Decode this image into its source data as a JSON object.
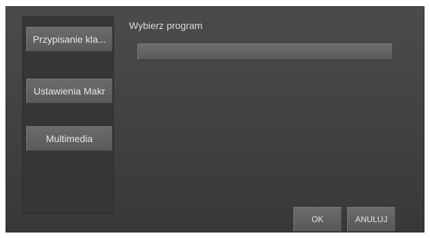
{
  "sidebar": {
    "items": [
      {
        "label": "Przypisanie kla..."
      },
      {
        "label": "Ustawienia Makr"
      },
      {
        "label": "Multimedia"
      }
    ]
  },
  "main": {
    "heading": "Wybierz program",
    "program_field_value": ""
  },
  "footer": {
    "ok_label": "OK",
    "cancel_label": "ANULUJ"
  },
  "colors": {
    "background": "#444444",
    "button": "#636363",
    "text": "#e6e6e6"
  }
}
